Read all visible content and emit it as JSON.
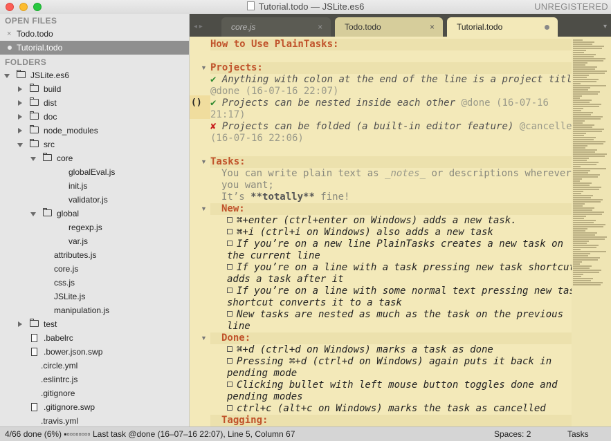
{
  "window": {
    "title": "Tutorial.todo — JSLite.es6",
    "registration": "UNREGISTERED"
  },
  "sidebar": {
    "open_files_header": "OPEN FILES",
    "open_files": [
      {
        "name": "Todo.todo",
        "marker": "×",
        "selected": false
      },
      {
        "name": "Tutorial.todo",
        "marker": "dot",
        "selected": true
      }
    ],
    "folders_header": "FOLDERS",
    "tree": [
      {
        "name": "JSLite.es6",
        "type": "folder",
        "level": 0,
        "expanded": true
      },
      {
        "name": "build",
        "type": "folder",
        "level": 1,
        "expanded": false
      },
      {
        "name": "dist",
        "type": "folder",
        "level": 1,
        "expanded": false
      },
      {
        "name": "doc",
        "type": "folder",
        "level": 1,
        "expanded": false
      },
      {
        "name": "node_modules",
        "type": "folder",
        "level": 1,
        "expanded": false
      },
      {
        "name": "src",
        "type": "folder",
        "level": 1,
        "expanded": true
      },
      {
        "name": "core",
        "type": "folder",
        "level": 2,
        "expanded": true
      },
      {
        "name": "globalEval.js",
        "type": "file",
        "level": 3
      },
      {
        "name": "init.js",
        "type": "file",
        "level": 3
      },
      {
        "name": "validator.js",
        "type": "file",
        "level": 3
      },
      {
        "name": "global",
        "type": "folder",
        "level": 2,
        "expanded": true
      },
      {
        "name": "regexp.js",
        "type": "file",
        "level": 3
      },
      {
        "name": "var.js",
        "type": "file",
        "level": 3
      },
      {
        "name": "attributes.js",
        "type": "file",
        "level": 2
      },
      {
        "name": "core.js",
        "type": "file",
        "level": 2
      },
      {
        "name": "css.js",
        "type": "file",
        "level": 2
      },
      {
        "name": "JSLite.js",
        "type": "file",
        "level": 2
      },
      {
        "name": "manipulation.js",
        "type": "file",
        "level": 2
      },
      {
        "name": "test",
        "type": "folder",
        "level": 1,
        "expanded": false
      },
      {
        "name": ".babelrc",
        "type": "file-icon",
        "level": 1
      },
      {
        "name": ".bower.json.swp",
        "type": "file-icon",
        "level": 1
      },
      {
        "name": ".circle.yml",
        "type": "file",
        "level": 1
      },
      {
        "name": ".eslintrc.js",
        "type": "file",
        "level": 1
      },
      {
        "name": ".gitignore",
        "type": "file",
        "level": 1
      },
      {
        "name": ".gitignore.swp",
        "type": "file-icon",
        "level": 1
      },
      {
        "name": ".travis.yml",
        "type": "file",
        "level": 1
      }
    ]
  },
  "tabs": [
    {
      "label": "core.js",
      "close": "×",
      "state": "dim"
    },
    {
      "label": "Todo.todo",
      "close": "×",
      "state": "inactive"
    },
    {
      "label": "Tutorial.todo",
      "close": "",
      "state": "active"
    }
  ],
  "tabbar": {
    "nav": "◂ ▸",
    "more": "▾"
  },
  "editor": {
    "title": "How to Use PlainTasks:",
    "projects_header": "Projects:",
    "p1_text": "Anything with colon at the end of the line is a project title",
    "p1_tag": "@done (16-07-16 22:07)",
    "p2_text": "Projects can be nested inside each other",
    "p2_tag": "@done (16-07-16",
    "p2_tag2": "21:17)",
    "p3_text": "Projects can be folded (a built-in editor feature)",
    "p3_tag": "@cancelled",
    "p3_tag2": "(16-07-16 22:06)",
    "gutter_marker": "()",
    "check": "✔",
    "cross": "✘",
    "tasks_header": "Tasks:",
    "note1a": "You can write plain text as ",
    "note1b": "_notes_",
    "note1c": " or descriptions wherever",
    "note2": "you want;",
    "note3a": "It’s ",
    "note3b": "**totally**",
    "note3c": " fine!",
    "new_header": "New:",
    "new_tasks": [
      "⌘+enter (ctrl+enter on Windows) adds a new task.",
      "⌘+i (ctrl+i on Windows) also adds a new task",
      "If you’re on a new line PlainTasks creates a new task on",
      "the current line",
      "If you’re on a line with a task pressing new task shortcut",
      "adds a task after it",
      "If you’re on a line with some normal text pressing new task",
      "shortcut converts it to a task",
      "New tasks are nested as much as the task on the previous",
      "line"
    ],
    "done_header": "Done:",
    "done_tasks": [
      "⌘+d (ctrl+d on Windows) marks a task as done",
      "Pressing ⌘+d (ctrl+d on Windows) again puts it back in",
      "pending mode",
      "Clicking bullet with left mouse button toggles done and",
      "pending modes",
      "ctrl+c (alt+c on Windows) marks the task as cancelled"
    ],
    "tagging_header": "Tagging:"
  },
  "statusbar": {
    "left": "4/66 done (6%) ▪▫▫▫▫▫▫▫▫ Last task @done (16–07–16 22:07), Line 5, Column 67",
    "spaces": "Spaces: 2",
    "syntax": "Tasks"
  }
}
